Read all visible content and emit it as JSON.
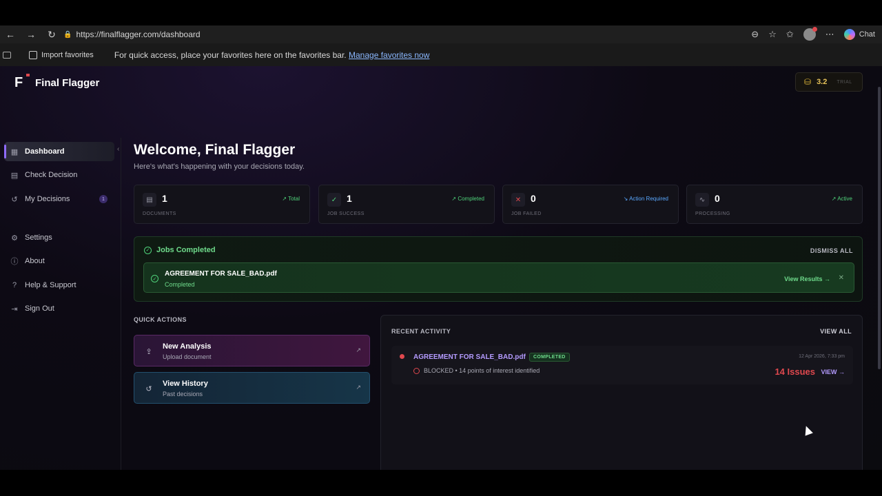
{
  "browser": {
    "url": "https://finalflagger.com/dashboard",
    "chat_label": "Chat",
    "favorites": {
      "import_label": "Import favorites",
      "message": "For quick access, place your favorites here on the favorites bar.",
      "manage_link": "Manage favorites now"
    }
  },
  "app": {
    "brand_initial": "F",
    "brand_name": "Final Flagger",
    "credits": {
      "value": "3.2",
      "tier": "TRIAL"
    }
  },
  "sidebar": {
    "items": [
      {
        "label": "Dashboard",
        "icon": "grid-icon"
      },
      {
        "label": "Check Decision",
        "icon": "document-icon"
      },
      {
        "label": "My Decisions",
        "icon": "history-icon",
        "badge": "1"
      },
      {
        "label": "Settings",
        "icon": "gear-icon"
      },
      {
        "label": "About",
        "icon": "info-icon"
      },
      {
        "label": "Help & Support",
        "icon": "help-icon"
      },
      {
        "label": "Sign Out",
        "icon": "sign-out-icon"
      }
    ]
  },
  "main": {
    "welcome": "Welcome, Final Flagger",
    "subtitle": "Here's what's happening with your decisions today.",
    "stats": [
      {
        "value": "1",
        "label": "DOCUMENTS",
        "trend": "Total",
        "trend_color": "#4fd27a"
      },
      {
        "value": "1",
        "label": "JOB SUCCESS",
        "trend": "Completed",
        "trend_color": "#4fd27a"
      },
      {
        "value": "0",
        "label": "JOB FAILED",
        "trend": "Action Required",
        "trend_color": "#5aa8ff"
      },
      {
        "value": "0",
        "label": "PROCESSING",
        "trend": "Active",
        "trend_color": "#4fd27a"
      }
    ],
    "jobs": {
      "title": "Jobs Completed",
      "dismiss": "DISMISS ALL",
      "item": {
        "name": "AGREEMENT FOR SALE_BAD.pdf",
        "status": "Completed",
        "action": "View Results →"
      }
    },
    "quick_actions": {
      "title": "QUICK ACTIONS",
      "items": [
        {
          "title": "New Analysis",
          "subtitle": "Upload document"
        },
        {
          "title": "View History",
          "subtitle": "Past decisions"
        }
      ]
    },
    "recent": {
      "title": "RECENT ACTIVITY",
      "view_all": "VIEW ALL",
      "item": {
        "name": "AGREEMENT FOR SALE_BAD.pdf",
        "badge": "COMPLETED",
        "desc": "BLOCKED • 14 points of interest identified",
        "time": "12 Apr 2026, 7:33 pm",
        "issues": "14 Issues",
        "view": "VIEW →"
      }
    }
  },
  "colors": {
    "accent": "#8f6bff",
    "success": "#4fd27a",
    "danger": "#e0484e",
    "info": "#5aa8ff"
  }
}
